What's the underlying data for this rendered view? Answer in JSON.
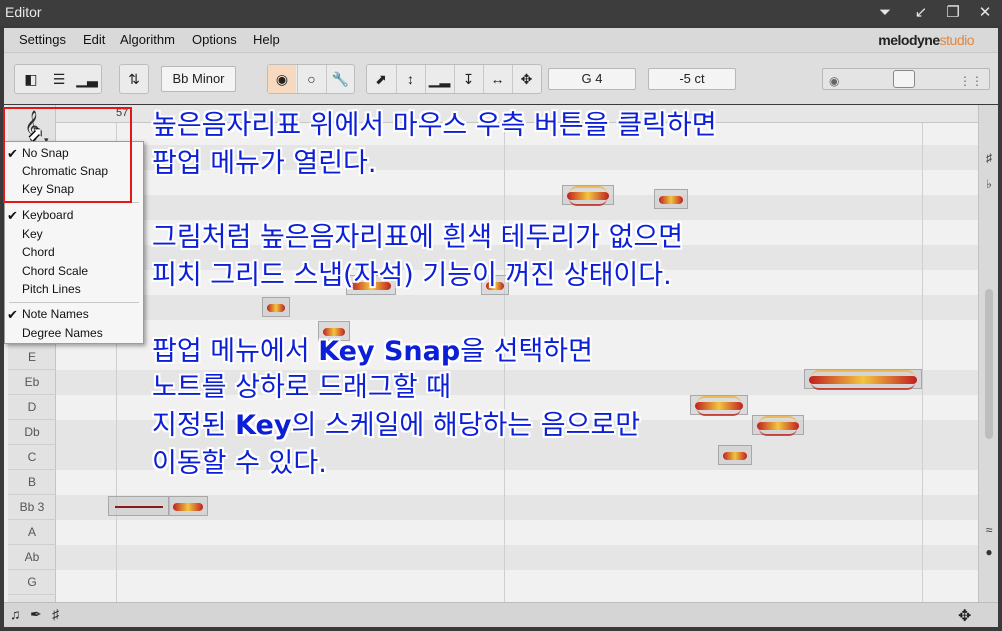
{
  "window": {
    "title": "Editor",
    "buttons": [
      {
        "name": "pin-icon",
        "glyph": "📌"
      },
      {
        "name": "collapse-icon",
        "glyph": "↙"
      },
      {
        "name": "restore-icon",
        "glyph": "❐"
      },
      {
        "name": "close-icon",
        "glyph": "✕"
      }
    ]
  },
  "menubar": {
    "items": [
      "Settings",
      "Edit",
      "Algorithm",
      "Options",
      "Help"
    ],
    "logo_main": "melodyne",
    "logo_suffix": "studio"
  },
  "toolbar": {
    "key_label": "Bb Minor",
    "pitch_display": "G 4",
    "cents_display": "-5 ct",
    "icons": [
      "layout-icon",
      "mixer-icon",
      "bars-icon",
      "transpose-icon",
      "blob-tool-icon",
      "note-tool-icon",
      "wrench-icon",
      "pointer-tool-icon",
      "pitch-tool-icon",
      "formant-tool-icon",
      "amplitude-tool-icon",
      "timing-tool-icon",
      "split-tool-icon"
    ]
  },
  "ruler": {
    "bar_number": "57"
  },
  "keys": [
    "E",
    "Eb",
    "D",
    "Db",
    "C",
    "B",
    "Bb 3",
    "A",
    "Ab",
    "G"
  ],
  "popup": {
    "items": [
      {
        "label": "No Snap",
        "checked": true
      },
      {
        "label": "Chromatic Snap",
        "checked": false
      },
      {
        "label": "Key Snap",
        "checked": false
      },
      {
        "sep": true
      },
      {
        "label": "Keyboard",
        "checked": true
      },
      {
        "label": "Key",
        "checked": false
      },
      {
        "label": "Chord",
        "checked": false
      },
      {
        "label": "Chord Scale",
        "checked": false
      },
      {
        "label": "Pitch Lines",
        "checked": false
      },
      {
        "sep": true
      },
      {
        "label": "Note Names",
        "checked": true
      },
      {
        "label": "Degree Names",
        "checked": false
      }
    ]
  },
  "annotation": {
    "line1": "높은음자리표 위에서 마우스 우측 버튼을 클릭하면",
    "line2": "팝업 메뉴가 열린다.",
    "line3": "그림처럼 높은음자리표에 흰색 테두리가 없으면",
    "line4": "피치 그리드 스냅(자석) 기능이 꺼진 상태이다.",
    "line5_pre": "팝업 메뉴에서 ",
    "line5_bold": "Key Snap",
    "line5_post": "을 선택하면",
    "line6": "노트를 상하로 드래그할 때",
    "line7_pre": "지정된 ",
    "line7_bold": "Key",
    "line7_post": "의 스케일에 해당하는 음으로만",
    "line8": "이동할 수 있다."
  },
  "colors": {
    "annotation": "#0b1fd6",
    "highlight": "#e01818",
    "accent": "#e2873a"
  }
}
